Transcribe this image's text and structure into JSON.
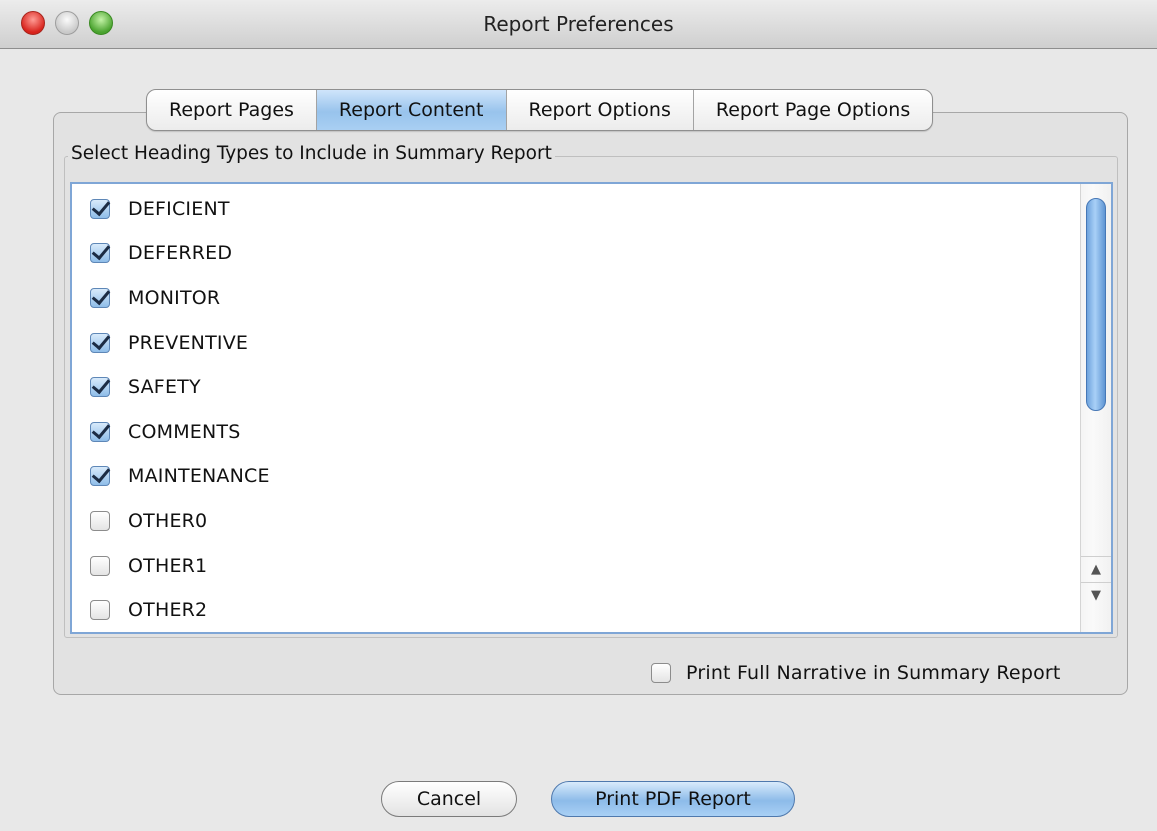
{
  "window": {
    "title": "Report Preferences"
  },
  "tabs": [
    {
      "label": "Report Pages",
      "active": false
    },
    {
      "label": "Report Content",
      "active": true
    },
    {
      "label": "Report Options",
      "active": false
    },
    {
      "label": "Report Page Options",
      "active": false
    }
  ],
  "group": {
    "label": "Select Heading Types to Include in Summary Report"
  },
  "headings": [
    {
      "label": "DEFICIENT",
      "checked": true
    },
    {
      "label": "DEFERRED",
      "checked": true
    },
    {
      "label": "MONITOR",
      "checked": true
    },
    {
      "label": "PREVENTIVE",
      "checked": true
    },
    {
      "label": "SAFETY",
      "checked": true
    },
    {
      "label": "COMMENTS",
      "checked": true
    },
    {
      "label": "MAINTENANCE",
      "checked": true
    },
    {
      "label": "OTHER0",
      "checked": false
    },
    {
      "label": "OTHER1",
      "checked": false
    },
    {
      "label": "OTHER2",
      "checked": false
    }
  ],
  "full_narrative": {
    "label": "Print Full Narrative in Summary Report",
    "checked": false
  },
  "buttons": {
    "cancel": "Cancel",
    "print": "Print PDF Report"
  },
  "colors": {
    "accent": "#8dbbe9",
    "selection_border": "#7fa6d6"
  }
}
